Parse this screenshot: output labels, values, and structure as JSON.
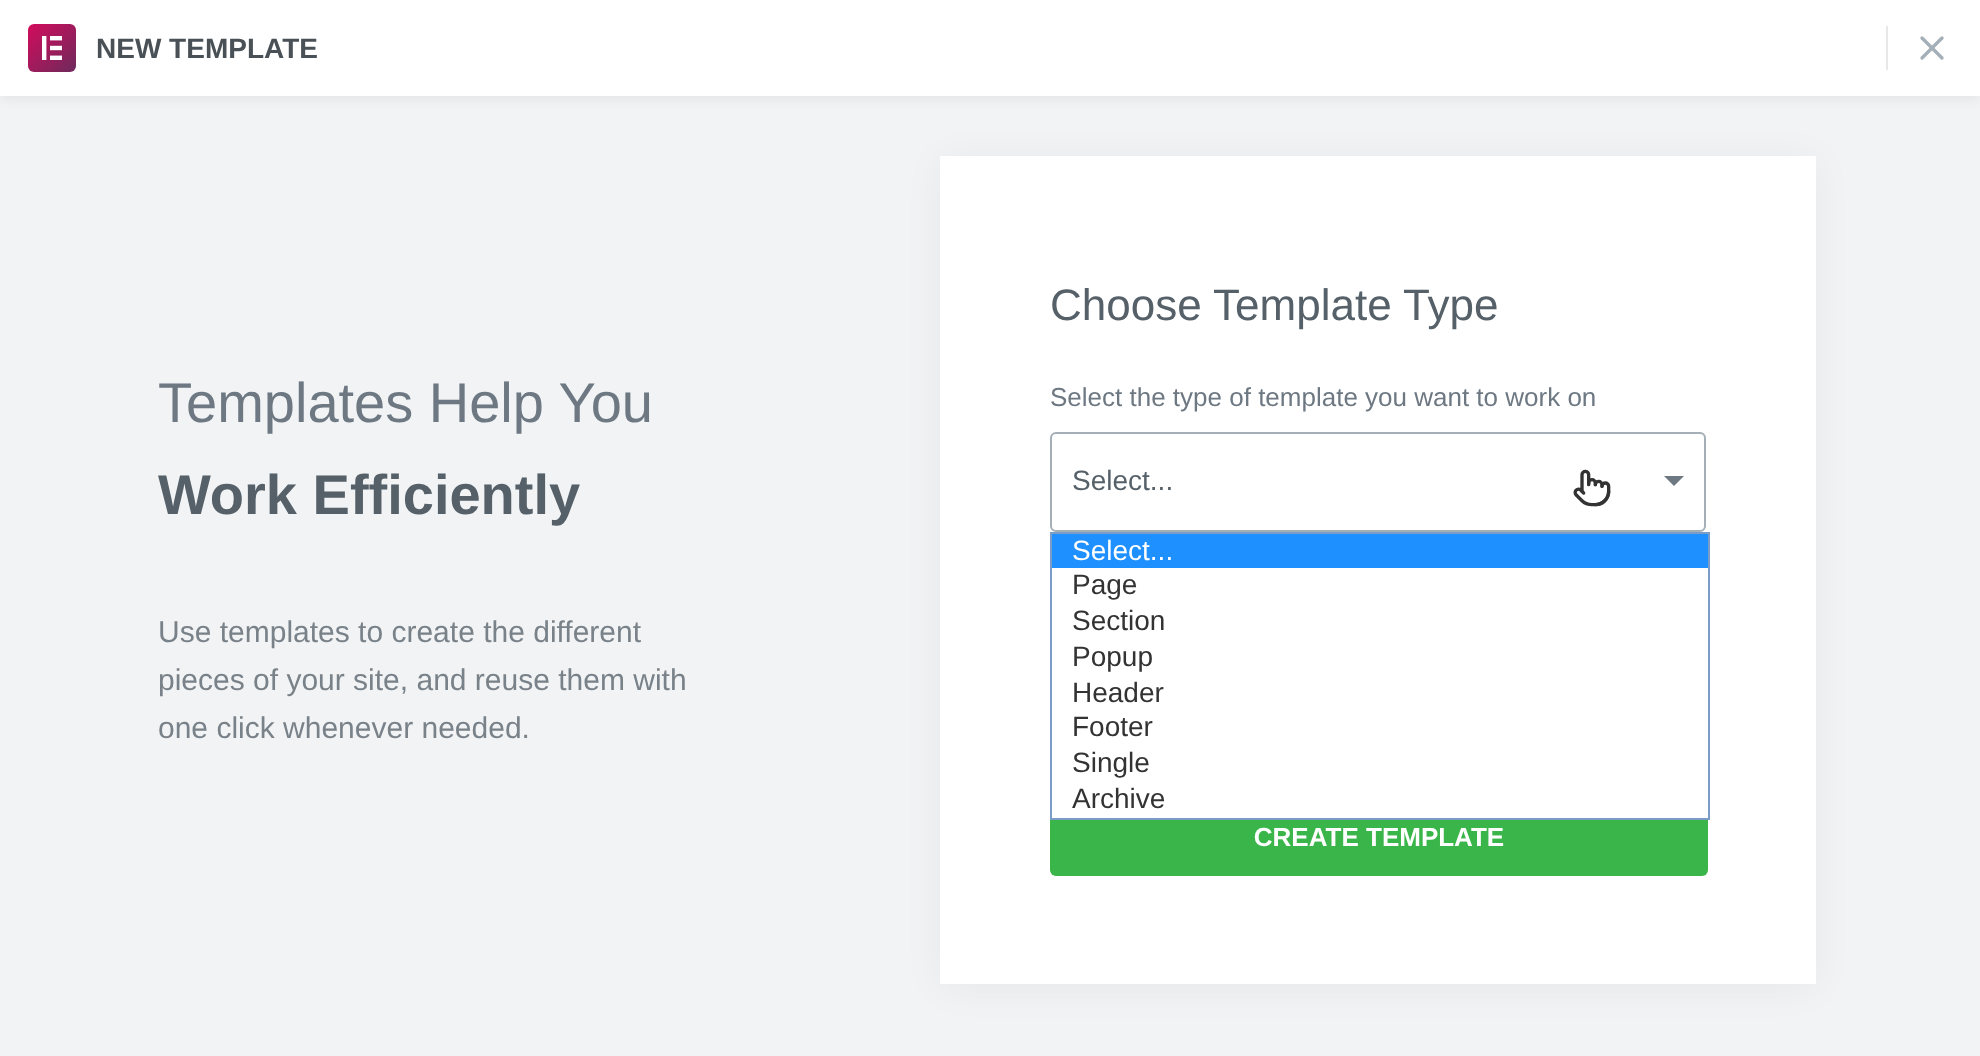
{
  "header": {
    "title": "NEW TEMPLATE"
  },
  "intro": {
    "heading_light": "Templates Help You",
    "heading_bold": "Work Efficiently",
    "description": "Use templates to create the different pieces of your site, and reuse them with one click whenever needed."
  },
  "form": {
    "title": "Choose Template Type",
    "label": "Select the type of template you want to work on",
    "select_value": "Select...",
    "expanded": true,
    "options": [
      {
        "label": "Select...",
        "selected": true
      },
      {
        "label": "Page",
        "selected": false
      },
      {
        "label": "Section",
        "selected": false
      },
      {
        "label": "Popup",
        "selected": false
      },
      {
        "label": "Header",
        "selected": false
      },
      {
        "label": "Footer",
        "selected": false
      },
      {
        "label": "Single",
        "selected": false
      },
      {
        "label": "Archive",
        "selected": false
      }
    ],
    "button": "CREATE TEMPLATE"
  }
}
